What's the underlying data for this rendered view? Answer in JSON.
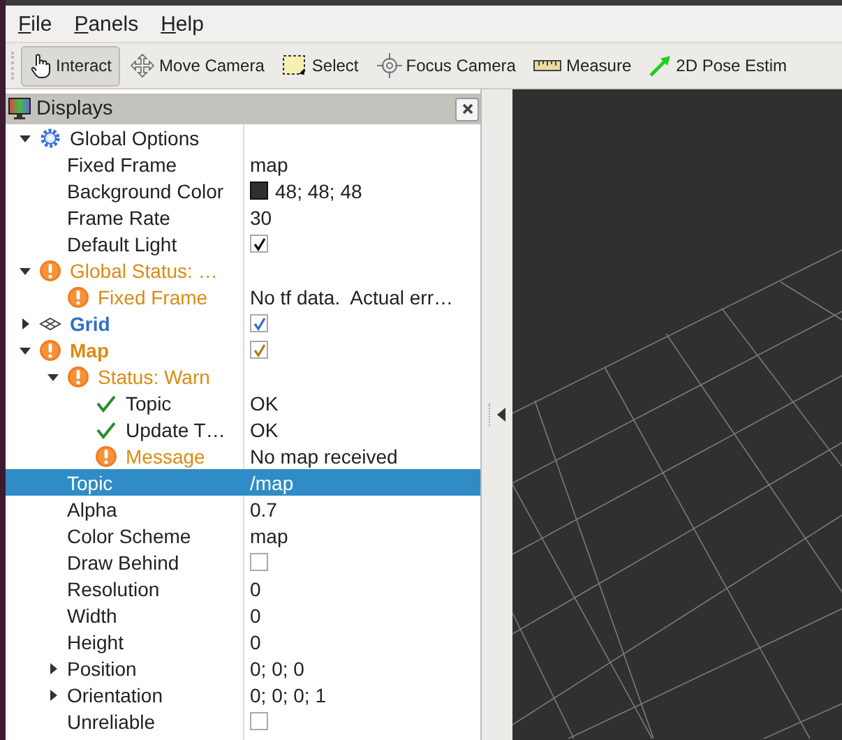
{
  "menu": [
    "File",
    "Panels",
    "Help"
  ],
  "toolbar": [
    {
      "label": "Interact",
      "selected": true
    },
    {
      "label": "Move Camera",
      "selected": false
    },
    {
      "label": "Select",
      "selected": false
    },
    {
      "label": "Focus Camera",
      "selected": false
    },
    {
      "label": "Measure",
      "selected": false
    },
    {
      "label": "2D Pose Estim",
      "selected": false
    }
  ],
  "panel": {
    "title": "Displays"
  },
  "tree": [
    {
      "name": "Global Options",
      "kind": "group",
      "expanded": true,
      "selected": false,
      "children": [
        {
          "name": "Fixed Frame",
          "value": "map",
          "selected": false
        },
        {
          "name": "Background Color",
          "color": "#303030",
          "value": "48; 48; 48",
          "selected": false
        },
        {
          "name": "Frame Rate",
          "value": "30",
          "selected": false
        },
        {
          "name": "Default Light",
          "checked": true,
          "selected": false
        }
      ]
    },
    {
      "name": "Global Status: …",
      "kind": "status",
      "warning": true,
      "expanded": true,
      "selected": false,
      "children": [
        {
          "name": "Fixed Frame",
          "kind": "status",
          "warning": true,
          "value": "No tf data.  Actual err…",
          "selected": false
        }
      ]
    },
    {
      "name": "Grid",
      "kind": "display",
      "warning": false,
      "expanded": false,
      "checked": true,
      "selected": false
    },
    {
      "name": "Map",
      "kind": "display",
      "warning": true,
      "expanded": true,
      "checked": true,
      "selected": false,
      "children": [
        {
          "name": "Status: Warn",
          "kind": "status",
          "warning": true,
          "expanded": true,
          "selected": false,
          "children": [
            {
              "name": "Topic",
              "kind": "status",
              "warning": false,
              "value": "OK",
              "selected": false
            },
            {
              "name": "Update T…",
              "kind": "status",
              "warning": false,
              "value": "OK",
              "selected": false
            },
            {
              "name": "Message",
              "kind": "status",
              "warning": true,
              "value": "No map received",
              "selected": false
            }
          ]
        },
        {
          "name": "Topic",
          "value": "/map",
          "selected": true
        },
        {
          "name": "Alpha",
          "value": "0.7",
          "selected": false
        },
        {
          "name": "Color Scheme",
          "value": "map",
          "selected": false
        },
        {
          "name": "Draw Behind",
          "checked": false,
          "selected": false
        },
        {
          "name": "Resolution",
          "value": "0",
          "selected": false
        },
        {
          "name": "Width",
          "value": "0",
          "selected": false
        },
        {
          "name": "Height",
          "value": "0",
          "selected": false
        },
        {
          "name": "Position",
          "expanded": false,
          "value": "0; 0; 0",
          "selected": false
        },
        {
          "name": "Orientation",
          "expanded": false,
          "value": "0; 0; 0; 1",
          "selected": false
        },
        {
          "name": "Unreliable",
          "checked": false,
          "selected": false
        }
      ]
    }
  ]
}
